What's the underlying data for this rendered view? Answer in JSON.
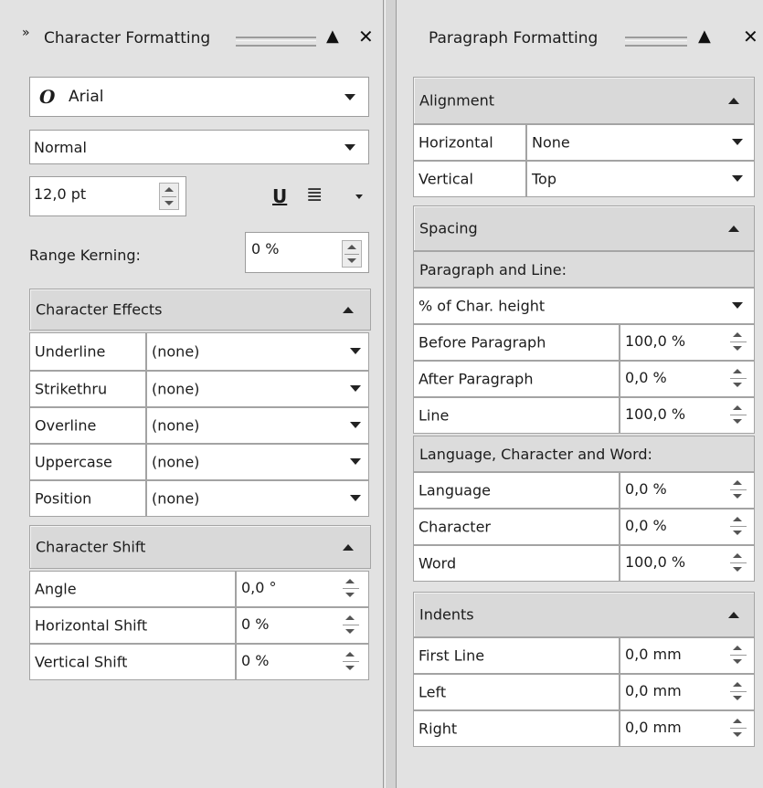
{
  "left": {
    "title": "Character Formatting",
    "font_name": "Arial",
    "font_style": "Normal",
    "font_size": "12,0 pt",
    "range_kerning_label": "Range Kerning:",
    "range_kerning_value": "0 %",
    "effects": {
      "title": "Character Effects",
      "rows": [
        {
          "label": "Underline",
          "value": "(none)"
        },
        {
          "label": "Strikethru",
          "value": "(none)"
        },
        {
          "label": "Overline",
          "value": "(none)"
        },
        {
          "label": "Uppercase",
          "value": "(none)"
        },
        {
          "label": "Position",
          "value": "(none)"
        }
      ]
    },
    "shift": {
      "title": "Character Shift",
      "rows": [
        {
          "label": "Angle",
          "value": "0,0 °"
        },
        {
          "label": "Horizontal Shift",
          "value": "0 %"
        },
        {
          "label": "Vertical Shift",
          "value": "0 %"
        }
      ]
    }
  },
  "right": {
    "title": "Paragraph Formatting",
    "alignment": {
      "title": "Alignment",
      "rows": [
        {
          "label": "Horizontal",
          "value": "None"
        },
        {
          "label": "Vertical",
          "value": "Top"
        }
      ]
    },
    "spacing": {
      "title": "Spacing",
      "para_line_label": "Paragraph and Line:",
      "unit": "% of Char. height",
      "rows": [
        {
          "label": "Before Paragraph",
          "value": "100,0 %"
        },
        {
          "label": "After Paragraph",
          "value": "0,0 %"
        },
        {
          "label": "Line",
          "value": "100,0 %"
        }
      ],
      "lcw_label": "Language, Character and Word:",
      "rows2": [
        {
          "label": "Language",
          "value": "0,0 %"
        },
        {
          "label": "Character",
          "value": "0,0 %"
        },
        {
          "label": "Word",
          "value": "100,0 %"
        }
      ]
    },
    "indents": {
      "title": "Indents",
      "rows": [
        {
          "label": "First Line",
          "value": "0,0 mm"
        },
        {
          "label": "Left",
          "value": "0,0 mm"
        },
        {
          "label": "Right",
          "value": "0,0 mm"
        }
      ]
    }
  }
}
